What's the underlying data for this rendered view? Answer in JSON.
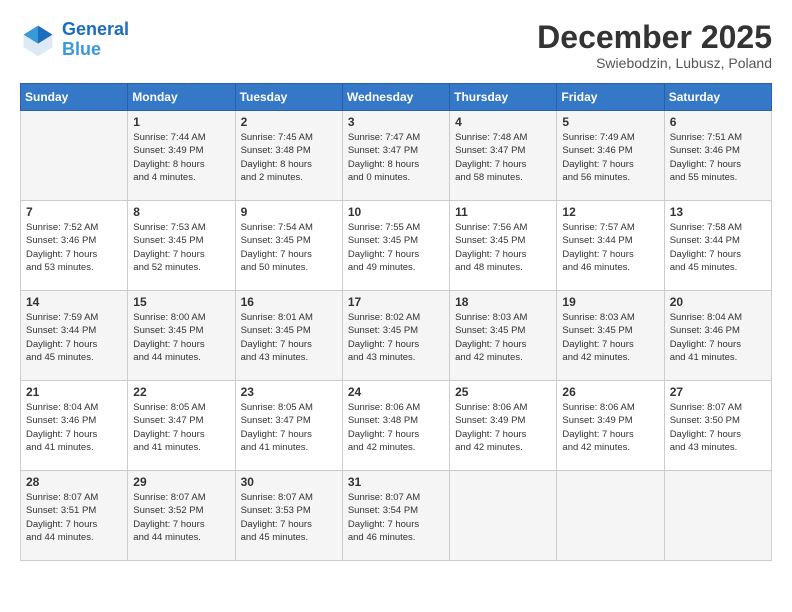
{
  "header": {
    "logo_line1": "General",
    "logo_line2": "Blue",
    "month": "December 2025",
    "location": "Swiebodzin, Lubusz, Poland"
  },
  "days_of_week": [
    "Sunday",
    "Monday",
    "Tuesday",
    "Wednesday",
    "Thursday",
    "Friday",
    "Saturday"
  ],
  "weeks": [
    [
      {
        "day": "",
        "info": ""
      },
      {
        "day": "1",
        "info": "Sunrise: 7:44 AM\nSunset: 3:49 PM\nDaylight: 8 hours\nand 4 minutes."
      },
      {
        "day": "2",
        "info": "Sunrise: 7:45 AM\nSunset: 3:48 PM\nDaylight: 8 hours\nand 2 minutes."
      },
      {
        "day": "3",
        "info": "Sunrise: 7:47 AM\nSunset: 3:47 PM\nDaylight: 8 hours\nand 0 minutes."
      },
      {
        "day": "4",
        "info": "Sunrise: 7:48 AM\nSunset: 3:47 PM\nDaylight: 7 hours\nand 58 minutes."
      },
      {
        "day": "5",
        "info": "Sunrise: 7:49 AM\nSunset: 3:46 PM\nDaylight: 7 hours\nand 56 minutes."
      },
      {
        "day": "6",
        "info": "Sunrise: 7:51 AM\nSunset: 3:46 PM\nDaylight: 7 hours\nand 55 minutes."
      }
    ],
    [
      {
        "day": "7",
        "info": "Sunrise: 7:52 AM\nSunset: 3:46 PM\nDaylight: 7 hours\nand 53 minutes."
      },
      {
        "day": "8",
        "info": "Sunrise: 7:53 AM\nSunset: 3:45 PM\nDaylight: 7 hours\nand 52 minutes."
      },
      {
        "day": "9",
        "info": "Sunrise: 7:54 AM\nSunset: 3:45 PM\nDaylight: 7 hours\nand 50 minutes."
      },
      {
        "day": "10",
        "info": "Sunrise: 7:55 AM\nSunset: 3:45 PM\nDaylight: 7 hours\nand 49 minutes."
      },
      {
        "day": "11",
        "info": "Sunrise: 7:56 AM\nSunset: 3:45 PM\nDaylight: 7 hours\nand 48 minutes."
      },
      {
        "day": "12",
        "info": "Sunrise: 7:57 AM\nSunset: 3:44 PM\nDaylight: 7 hours\nand 46 minutes."
      },
      {
        "day": "13",
        "info": "Sunrise: 7:58 AM\nSunset: 3:44 PM\nDaylight: 7 hours\nand 45 minutes."
      }
    ],
    [
      {
        "day": "14",
        "info": "Sunrise: 7:59 AM\nSunset: 3:44 PM\nDaylight: 7 hours\nand 45 minutes."
      },
      {
        "day": "15",
        "info": "Sunrise: 8:00 AM\nSunset: 3:45 PM\nDaylight: 7 hours\nand 44 minutes."
      },
      {
        "day": "16",
        "info": "Sunrise: 8:01 AM\nSunset: 3:45 PM\nDaylight: 7 hours\nand 43 minutes."
      },
      {
        "day": "17",
        "info": "Sunrise: 8:02 AM\nSunset: 3:45 PM\nDaylight: 7 hours\nand 43 minutes."
      },
      {
        "day": "18",
        "info": "Sunrise: 8:03 AM\nSunset: 3:45 PM\nDaylight: 7 hours\nand 42 minutes."
      },
      {
        "day": "19",
        "info": "Sunrise: 8:03 AM\nSunset: 3:45 PM\nDaylight: 7 hours\nand 42 minutes."
      },
      {
        "day": "20",
        "info": "Sunrise: 8:04 AM\nSunset: 3:46 PM\nDaylight: 7 hours\nand 41 minutes."
      }
    ],
    [
      {
        "day": "21",
        "info": "Sunrise: 8:04 AM\nSunset: 3:46 PM\nDaylight: 7 hours\nand 41 minutes."
      },
      {
        "day": "22",
        "info": "Sunrise: 8:05 AM\nSunset: 3:47 PM\nDaylight: 7 hours\nand 41 minutes."
      },
      {
        "day": "23",
        "info": "Sunrise: 8:05 AM\nSunset: 3:47 PM\nDaylight: 7 hours\nand 41 minutes."
      },
      {
        "day": "24",
        "info": "Sunrise: 8:06 AM\nSunset: 3:48 PM\nDaylight: 7 hours\nand 42 minutes."
      },
      {
        "day": "25",
        "info": "Sunrise: 8:06 AM\nSunset: 3:49 PM\nDaylight: 7 hours\nand 42 minutes."
      },
      {
        "day": "26",
        "info": "Sunrise: 8:06 AM\nSunset: 3:49 PM\nDaylight: 7 hours\nand 42 minutes."
      },
      {
        "day": "27",
        "info": "Sunrise: 8:07 AM\nSunset: 3:50 PM\nDaylight: 7 hours\nand 43 minutes."
      }
    ],
    [
      {
        "day": "28",
        "info": "Sunrise: 8:07 AM\nSunset: 3:51 PM\nDaylight: 7 hours\nand 44 minutes."
      },
      {
        "day": "29",
        "info": "Sunrise: 8:07 AM\nSunset: 3:52 PM\nDaylight: 7 hours\nand 44 minutes."
      },
      {
        "day": "30",
        "info": "Sunrise: 8:07 AM\nSunset: 3:53 PM\nDaylight: 7 hours\nand 45 minutes."
      },
      {
        "day": "31",
        "info": "Sunrise: 8:07 AM\nSunset: 3:54 PM\nDaylight: 7 hours\nand 46 minutes."
      },
      {
        "day": "",
        "info": ""
      },
      {
        "day": "",
        "info": ""
      },
      {
        "day": "",
        "info": ""
      }
    ]
  ]
}
